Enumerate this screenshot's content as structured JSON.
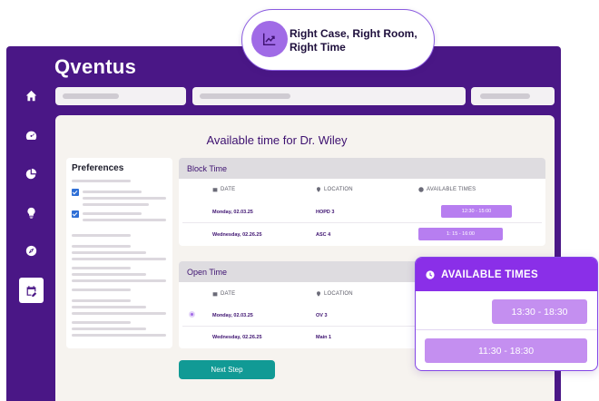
{
  "app": {
    "logo": "Qventus"
  },
  "sidebar": {
    "items": [
      {
        "name": "home-icon"
      },
      {
        "name": "gauge-icon"
      },
      {
        "name": "pie-chart-icon"
      },
      {
        "name": "lightbulb-icon"
      },
      {
        "name": "compass-icon"
      },
      {
        "name": "calendar-edit-icon",
        "active": true
      }
    ]
  },
  "main": {
    "title": "Available time for Dr. Wiley"
  },
  "preferences": {
    "title": "Preferences"
  },
  "block_time": {
    "title": "Block Time",
    "columns": {
      "date": "DATE",
      "location": "LOCATION",
      "times": "AVAILABLE TIMES"
    },
    "rows": [
      {
        "date": "Monday, 02.03.25",
        "location": "HOPD 3",
        "time": "12:30 - 15:00"
      },
      {
        "date": "Wednesday, 02.26.25",
        "location": "ASC 4",
        "time": "1: 15 - 16:00"
      }
    ]
  },
  "open_time": {
    "title": "Open Time",
    "columns": {
      "date": "DATE",
      "location": "LOCATION"
    },
    "rows": [
      {
        "date": "Monday, 02.03.25",
        "location": "OV 3",
        "selected": true
      },
      {
        "date": "Wednesday, 02.26.25",
        "location": "Main 1",
        "selected": false
      }
    ]
  },
  "actions": {
    "next_label": "Next Step"
  },
  "badge": {
    "text": "Right Case, Right Room, Right Time"
  },
  "popup": {
    "title": "AVAILABLE TIMES",
    "times": [
      "13:30 - 18:30",
      "11:30 - 18:30"
    ]
  },
  "colors": {
    "brand": "#4a1786",
    "accent": "#8a2fe8",
    "pill": "#b77ef0",
    "teal": "#119a95"
  }
}
